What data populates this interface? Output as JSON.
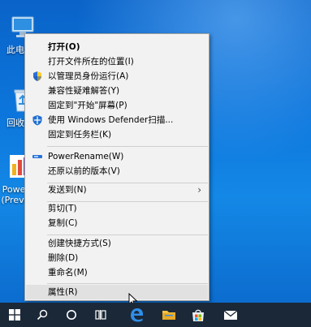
{
  "desktop": {
    "icons": [
      {
        "label": "此电",
        "name": "this-pc-icon"
      },
      {
        "label": "回收",
        "name": "recycle-bin-icon"
      },
      {
        "label": "Powe\n(Previ",
        "name": "powerrename-app-icon"
      }
    ]
  },
  "context_menu": {
    "items": [
      {
        "label": "打开(O)",
        "bold": true
      },
      {
        "label": "打开文件所在的位置(I)"
      },
      {
        "label": "以管理员身份运行(A)",
        "icon": "uac-shield-icon"
      },
      {
        "label": "兼容性疑难解答(Y)"
      },
      {
        "label": "固定到\"开始\"屏幕(P)"
      },
      {
        "label": "使用 Windows Defender扫描...",
        "icon": "windows-defender-icon"
      },
      {
        "label": "固定到任务栏(K)"
      },
      {
        "label": "PowerRename(W)",
        "icon": "powerrename-icon"
      },
      {
        "label": "还原以前的版本(V)"
      },
      {
        "label": "发送到(N)",
        "submenu": true
      },
      {
        "label": "剪切(T)"
      },
      {
        "label": "复制(C)"
      },
      {
        "label": "创建快捷方式(S)"
      },
      {
        "label": "删除(D)"
      },
      {
        "label": "重命名(M)"
      },
      {
        "label": "属性(R)",
        "hovered": true
      }
    ],
    "submenu_arrow": "›"
  },
  "taskbar": {
    "items": [
      "start-button",
      "search-button",
      "task-view-button",
      "timeline-button",
      "edge-browser",
      "file-explorer",
      "microsoft-store",
      "mail"
    ]
  },
  "colors": {
    "menu_bg": "#f2f2f2",
    "hover_bg": "#e1e1e1",
    "taskbar_bg": "#1b2838",
    "desktop_blue": "#0c76dc"
  }
}
